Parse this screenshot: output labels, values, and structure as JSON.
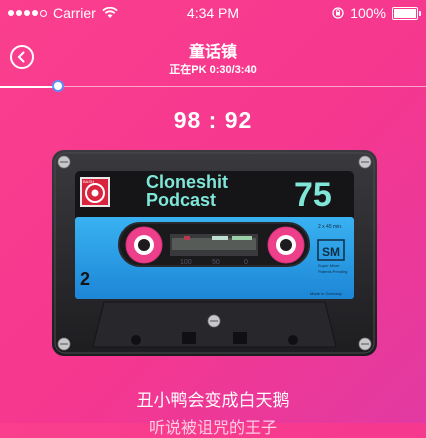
{
  "status_bar": {
    "carrier": "Carrier",
    "time": "4:34 PM",
    "battery": "100%",
    "signal_bars": 4
  },
  "header": {
    "title": "童话镇",
    "subtitle": "正在PK 0:30/3:40"
  },
  "player": {
    "progress": 0.136
  },
  "score": "98 : 92",
  "cassette": {
    "brand": "Cloneshit",
    "name": "Podcast",
    "number": "75",
    "side": "2",
    "duration": "2 x 45 min.",
    "badge": "SM",
    "badge_sub": "Super Mixer",
    "patents": "Patents Pending",
    "made_in": "Made in Germany",
    "label_logo": "BASH",
    "counter": [
      "100",
      "50",
      "0"
    ]
  },
  "lyrics": {
    "current": "丑小鸭会变成白天鹅",
    "next": "听说被诅咒的王子"
  },
  "colors": {
    "background": "#fb3f8e",
    "tape_accent": "#7fe6d8",
    "tape_band": "#2fa3ea",
    "reel_pink": "#ee3f8b"
  }
}
